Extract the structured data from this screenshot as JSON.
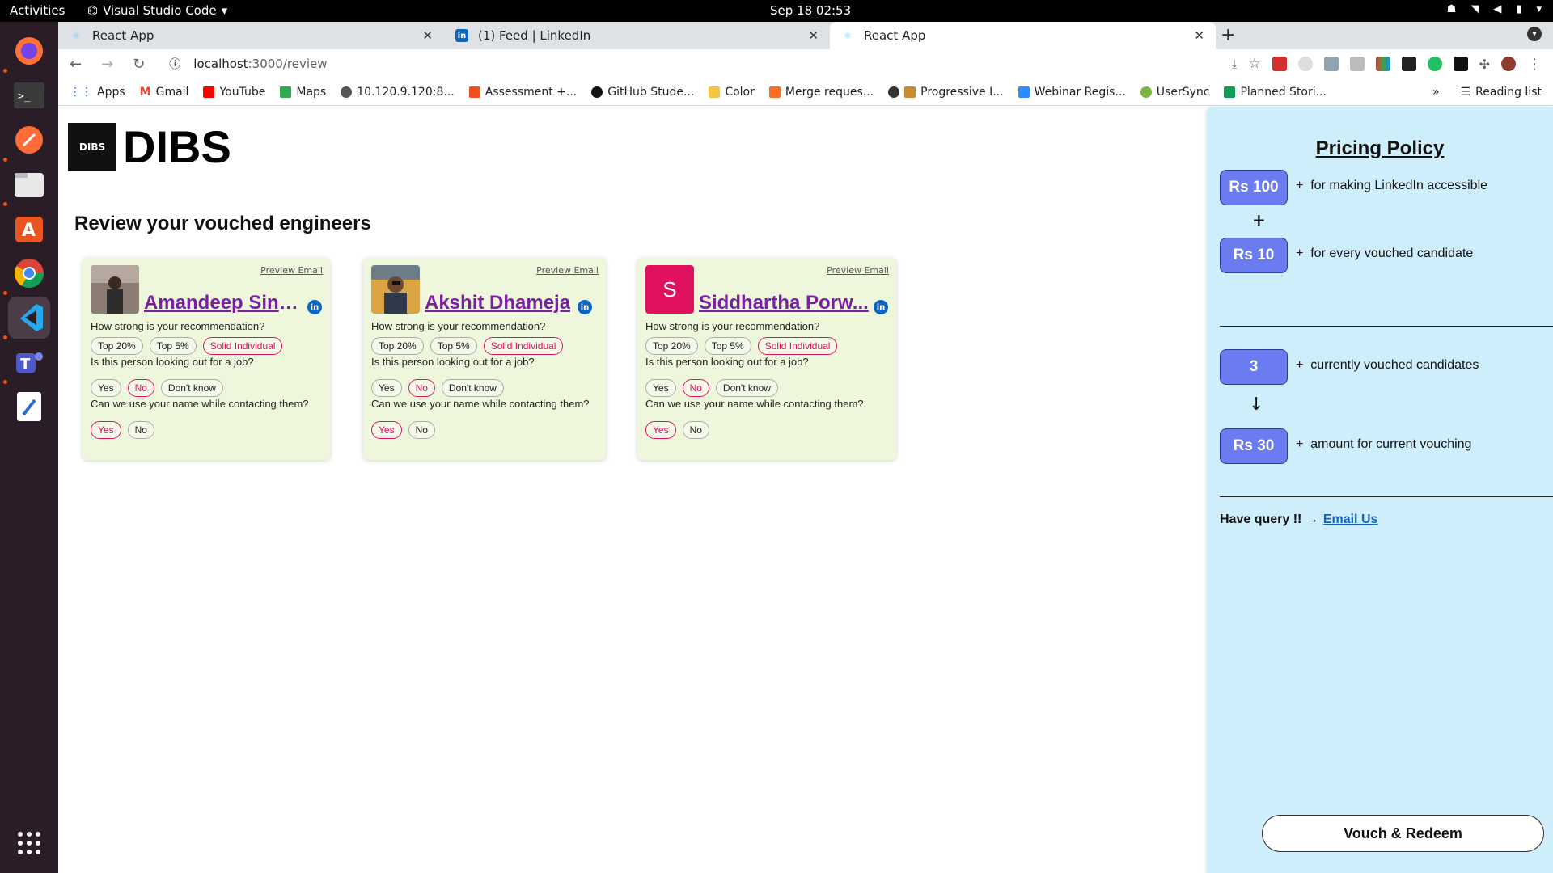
{
  "os": {
    "activities": "Activities",
    "app_name": "Visual Studio Code",
    "clock": "Sep 18  02:53"
  },
  "browser": {
    "tabs": [
      {
        "label": "React App",
        "active": false
      },
      {
        "label": "(1) Feed | LinkedIn",
        "active": false
      },
      {
        "label": "React App",
        "active": true
      }
    ],
    "url_host": "localhost",
    "url_path": ":3000/review",
    "bookmarks": [
      "Apps",
      "Gmail",
      "YouTube",
      "Maps",
      "10.120.9.120:8...",
      "Assessment +...",
      "GitHub Stude...",
      "Color",
      "Merge reques...",
      "Progressive I...",
      "Webinar Regis...",
      "UserSync",
      "Planned Stori..."
    ],
    "reading_list": "Reading list",
    "overflow": "»"
  },
  "app": {
    "logo_mark": "DIBS",
    "logo_text": "DIBS",
    "heading": "Review your vouched engineers",
    "preview_label": "Preview Email",
    "linkedin_badge": "in",
    "q1": "How strong is your recommendation?",
    "q2": "Is this person looking out for a job?",
    "q3": "Can we use your name while contacting them?",
    "q1_opts": [
      "Top 20%",
      "Top 5%",
      "Solid Individual"
    ],
    "q2_opts": [
      "Yes",
      "No",
      "Don't know"
    ],
    "q3_opts": [
      "Yes",
      "No"
    ],
    "candidates": [
      {
        "name": "Amandeep Singh",
        "initial": "",
        "q1": "Solid Individual",
        "q2": "No",
        "q3": "Yes"
      },
      {
        "name": "Akshit Dhameja",
        "initial": "",
        "q1": "Solid Individual",
        "q2": "No",
        "q3": "Yes"
      },
      {
        "name": "Siddhartha Porw...",
        "initial": "S",
        "q1": "Solid Individual",
        "q2": "No",
        "q3": "Yes"
      }
    ]
  },
  "pricing": {
    "title": "Pricing Policy",
    "rows": [
      {
        "pill": "Rs 100",
        "text": "for making LinkedIn accessible"
      },
      {
        "pill": "Rs 10",
        "text": "for every vouched candidate"
      },
      {
        "pill": "3",
        "text": "currently vouched candidates"
      },
      {
        "pill": "Rs 30",
        "text": "amount for current vouching"
      }
    ],
    "plus_sign": "+",
    "bullet_plus": "+",
    "down_arrow": "↓",
    "query_label": "Have query !! →",
    "query_link": "Email Us",
    "redeem_button": "Vouch & Redeem"
  },
  "colors": {
    "card_bg": "#eef7dc",
    "selected_chip": "#e0115f",
    "pill": "#6b7cf0",
    "sidebar_bg": "#cfeefb",
    "name_link": "#7b1fa2",
    "linkedin": "#0a66c2"
  }
}
